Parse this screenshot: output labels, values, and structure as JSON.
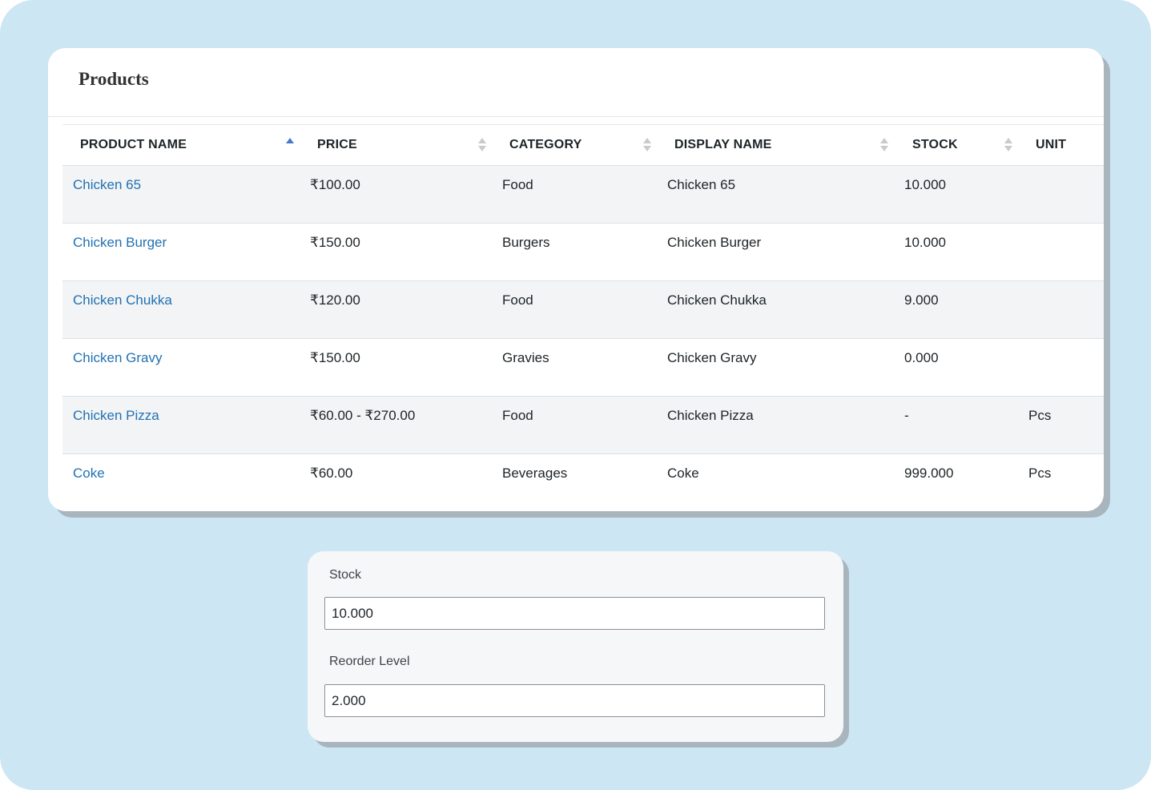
{
  "products_card": {
    "title": "Products"
  },
  "table": {
    "columns": [
      {
        "label": "PRODUCT NAME",
        "sort": "asc"
      },
      {
        "label": "PRICE",
        "sort": "none"
      },
      {
        "label": "CATEGORY",
        "sort": "none"
      },
      {
        "label": "DISPLAY NAME",
        "sort": "none"
      },
      {
        "label": "STOCK",
        "sort": "none"
      },
      {
        "label": "UNIT",
        "sort": ""
      }
    ],
    "rows": [
      {
        "name": "Chicken 65",
        "price": "₹100.00",
        "category": "Food",
        "display_name": "Chicken 65",
        "stock": "10.000",
        "unit": ""
      },
      {
        "name": "Chicken Burger",
        "price": "₹150.00",
        "category": "Burgers",
        "display_name": "Chicken Burger",
        "stock": "10.000",
        "unit": ""
      },
      {
        "name": "Chicken Chukka",
        "price": "₹120.00",
        "category": "Food",
        "display_name": "Chicken Chukka",
        "stock": "9.000",
        "unit": ""
      },
      {
        "name": "Chicken Gravy",
        "price": "₹150.00",
        "category": "Gravies",
        "display_name": "Chicken Gravy",
        "stock": "0.000",
        "unit": ""
      },
      {
        "name": "Chicken Pizza",
        "price": "₹60.00 - ₹270.00",
        "category": "Food",
        "display_name": "Chicken Pizza",
        "stock": "-",
        "unit": "Pcs"
      },
      {
        "name": "Coke",
        "price": "₹60.00",
        "category": "Beverages",
        "display_name": "Coke",
        "stock": "999.000",
        "unit": "Pcs"
      }
    ]
  },
  "stock_form": {
    "stock_label": "Stock",
    "stock_value": "10.000",
    "reorder_label": "Reorder Level",
    "reorder_value": "2.000"
  },
  "colors": {
    "background": "#cce6f4",
    "link": "#2271b1",
    "sort_active": "#4a78c9"
  }
}
